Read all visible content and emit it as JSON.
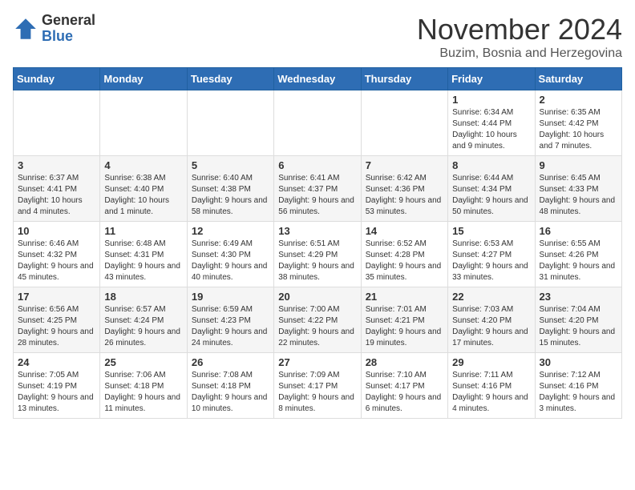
{
  "logo": {
    "general": "General",
    "blue": "Blue"
  },
  "header": {
    "month": "November 2024",
    "location": "Buzim, Bosnia and Herzegovina"
  },
  "weekdays": [
    "Sunday",
    "Monday",
    "Tuesday",
    "Wednesday",
    "Thursday",
    "Friday",
    "Saturday"
  ],
  "weeks": [
    [
      {
        "day": "",
        "detail": ""
      },
      {
        "day": "",
        "detail": ""
      },
      {
        "day": "",
        "detail": ""
      },
      {
        "day": "",
        "detail": ""
      },
      {
        "day": "",
        "detail": ""
      },
      {
        "day": "1",
        "detail": "Sunrise: 6:34 AM\nSunset: 4:44 PM\nDaylight: 10 hours and 9 minutes."
      },
      {
        "day": "2",
        "detail": "Sunrise: 6:35 AM\nSunset: 4:42 PM\nDaylight: 10 hours and 7 minutes."
      }
    ],
    [
      {
        "day": "3",
        "detail": "Sunrise: 6:37 AM\nSunset: 4:41 PM\nDaylight: 10 hours and 4 minutes."
      },
      {
        "day": "4",
        "detail": "Sunrise: 6:38 AM\nSunset: 4:40 PM\nDaylight: 10 hours and 1 minute."
      },
      {
        "day": "5",
        "detail": "Sunrise: 6:40 AM\nSunset: 4:38 PM\nDaylight: 9 hours and 58 minutes."
      },
      {
        "day": "6",
        "detail": "Sunrise: 6:41 AM\nSunset: 4:37 PM\nDaylight: 9 hours and 56 minutes."
      },
      {
        "day": "7",
        "detail": "Sunrise: 6:42 AM\nSunset: 4:36 PM\nDaylight: 9 hours and 53 minutes."
      },
      {
        "day": "8",
        "detail": "Sunrise: 6:44 AM\nSunset: 4:34 PM\nDaylight: 9 hours and 50 minutes."
      },
      {
        "day": "9",
        "detail": "Sunrise: 6:45 AM\nSunset: 4:33 PM\nDaylight: 9 hours and 48 minutes."
      }
    ],
    [
      {
        "day": "10",
        "detail": "Sunrise: 6:46 AM\nSunset: 4:32 PM\nDaylight: 9 hours and 45 minutes."
      },
      {
        "day": "11",
        "detail": "Sunrise: 6:48 AM\nSunset: 4:31 PM\nDaylight: 9 hours and 43 minutes."
      },
      {
        "day": "12",
        "detail": "Sunrise: 6:49 AM\nSunset: 4:30 PM\nDaylight: 9 hours and 40 minutes."
      },
      {
        "day": "13",
        "detail": "Sunrise: 6:51 AM\nSunset: 4:29 PM\nDaylight: 9 hours and 38 minutes."
      },
      {
        "day": "14",
        "detail": "Sunrise: 6:52 AM\nSunset: 4:28 PM\nDaylight: 9 hours and 35 minutes."
      },
      {
        "day": "15",
        "detail": "Sunrise: 6:53 AM\nSunset: 4:27 PM\nDaylight: 9 hours and 33 minutes."
      },
      {
        "day": "16",
        "detail": "Sunrise: 6:55 AM\nSunset: 4:26 PM\nDaylight: 9 hours and 31 minutes."
      }
    ],
    [
      {
        "day": "17",
        "detail": "Sunrise: 6:56 AM\nSunset: 4:25 PM\nDaylight: 9 hours and 28 minutes."
      },
      {
        "day": "18",
        "detail": "Sunrise: 6:57 AM\nSunset: 4:24 PM\nDaylight: 9 hours and 26 minutes."
      },
      {
        "day": "19",
        "detail": "Sunrise: 6:59 AM\nSunset: 4:23 PM\nDaylight: 9 hours and 24 minutes."
      },
      {
        "day": "20",
        "detail": "Sunrise: 7:00 AM\nSunset: 4:22 PM\nDaylight: 9 hours and 22 minutes."
      },
      {
        "day": "21",
        "detail": "Sunrise: 7:01 AM\nSunset: 4:21 PM\nDaylight: 9 hours and 19 minutes."
      },
      {
        "day": "22",
        "detail": "Sunrise: 7:03 AM\nSunset: 4:20 PM\nDaylight: 9 hours and 17 minutes."
      },
      {
        "day": "23",
        "detail": "Sunrise: 7:04 AM\nSunset: 4:20 PM\nDaylight: 9 hours and 15 minutes."
      }
    ],
    [
      {
        "day": "24",
        "detail": "Sunrise: 7:05 AM\nSunset: 4:19 PM\nDaylight: 9 hours and 13 minutes."
      },
      {
        "day": "25",
        "detail": "Sunrise: 7:06 AM\nSunset: 4:18 PM\nDaylight: 9 hours and 11 minutes."
      },
      {
        "day": "26",
        "detail": "Sunrise: 7:08 AM\nSunset: 4:18 PM\nDaylight: 9 hours and 10 minutes."
      },
      {
        "day": "27",
        "detail": "Sunrise: 7:09 AM\nSunset: 4:17 PM\nDaylight: 9 hours and 8 minutes."
      },
      {
        "day": "28",
        "detail": "Sunrise: 7:10 AM\nSunset: 4:17 PM\nDaylight: 9 hours and 6 minutes."
      },
      {
        "day": "29",
        "detail": "Sunrise: 7:11 AM\nSunset: 4:16 PM\nDaylight: 9 hours and 4 minutes."
      },
      {
        "day": "30",
        "detail": "Sunrise: 7:12 AM\nSunset: 4:16 PM\nDaylight: 9 hours and 3 minutes."
      }
    ]
  ]
}
